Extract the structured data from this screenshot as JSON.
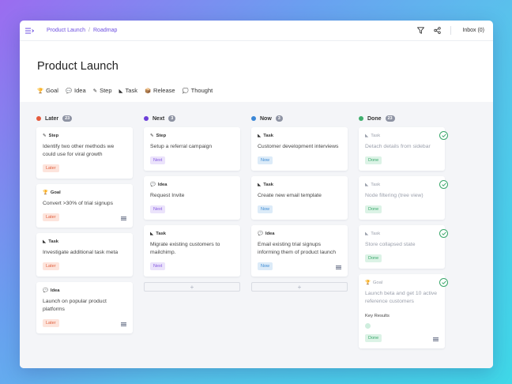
{
  "breadcrumb": {
    "project": "Product Launch",
    "separator": "/",
    "view": "Roadmap"
  },
  "topbar": {
    "inbox": "Inbox (0)"
  },
  "page": {
    "title": "Product Launch"
  },
  "legend": [
    {
      "icon": "🏆",
      "label": "Goal",
      "icon_name": "trophy-icon"
    },
    {
      "icon": "💬",
      "label": "Idea",
      "icon_name": "speech-bubble-icon"
    },
    {
      "icon": "✎",
      "label": "Step",
      "icon_name": "pencil-icon"
    },
    {
      "icon": "◣",
      "label": "Task",
      "icon_name": "task-icon"
    },
    {
      "icon": "📦",
      "label": "Release",
      "icon_name": "release-icon"
    },
    {
      "icon": "💭",
      "label": "Thought",
      "icon_name": "thought-icon"
    }
  ],
  "colors": {
    "later": "#e55a3c",
    "next": "#6c3fd8",
    "now": "#3b87d6",
    "done": "#3fae6d",
    "accent": "#6d4fe0"
  },
  "columns": [
    {
      "name": "Later",
      "count": "23",
      "cards": [
        {
          "type_icon": "✎",
          "type": "Step",
          "title": "Identify two other methods we could use for viral growth",
          "badge": "Later"
        },
        {
          "type_icon": "🏆",
          "type": "Goal",
          "title": "Convert >30% of trial signups",
          "badge": "Later",
          "has_sub": true
        },
        {
          "type_icon": "◣",
          "type": "Task",
          "title": "Investigate additional task meta",
          "badge": "Later"
        },
        {
          "type_icon": "💬",
          "type": "Idea",
          "title": "Launch on popular product platforms",
          "badge": "Later",
          "has_sub": true
        }
      ]
    },
    {
      "name": "Next",
      "count": "3",
      "cards": [
        {
          "type_icon": "✎",
          "type": "Step",
          "title": "Setup a referral campaign",
          "badge": "Next"
        },
        {
          "type_icon": "💬",
          "type": "Idea",
          "title": "Request Invite",
          "badge": "Next"
        },
        {
          "type_icon": "◣",
          "type": "Task",
          "title": "Migrate existing customers to mailchimp.",
          "badge": "Next"
        }
      ],
      "add": "+"
    },
    {
      "name": "Now",
      "count": "3",
      "cards": [
        {
          "type_icon": "◣",
          "type": "Task",
          "title": "Customer development interviews",
          "badge": "Now"
        },
        {
          "type_icon": "◣",
          "type": "Task",
          "title": "Create new email template",
          "badge": "Now"
        },
        {
          "type_icon": "💬",
          "type": "Idea",
          "title": "Email existing trial signups informing them of product launch",
          "badge": "Now",
          "has_sub": true
        }
      ],
      "add": "+"
    },
    {
      "name": "Done",
      "count": "23",
      "cards": [
        {
          "type_icon": "◣",
          "type": "Task",
          "title": "Detach details from sidebar",
          "badge": "Done"
        },
        {
          "type_icon": "◣",
          "type": "Task",
          "title": "Node filtering (tree view)",
          "badge": "Done"
        },
        {
          "type_icon": "◣",
          "type": "Task",
          "title": "Store collapsed state",
          "badge": "Done"
        },
        {
          "type_icon": "🏆",
          "type": "Goal",
          "title": "Launch beta and get 10 active reference customers",
          "key_results": "Key Results",
          "badge": "Done",
          "has_sub": true
        }
      ]
    }
  ]
}
